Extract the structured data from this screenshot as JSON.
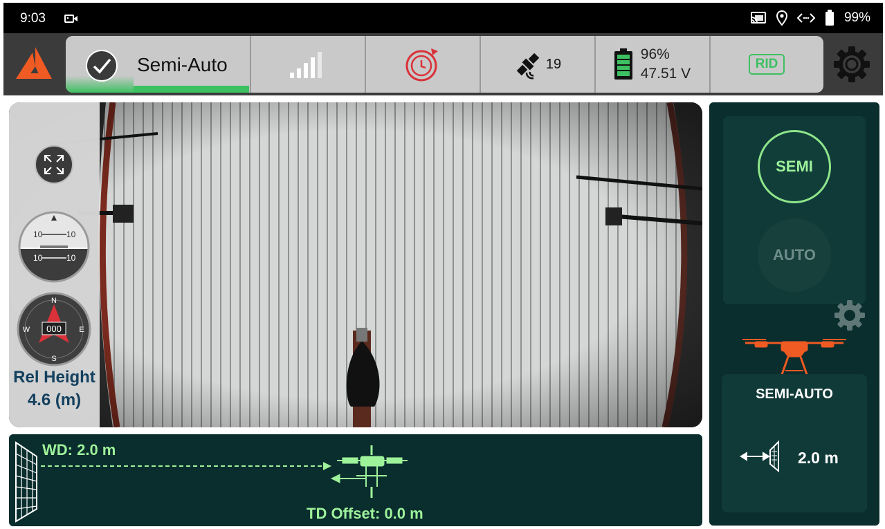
{
  "status_bar": {
    "time": "9:03",
    "battery_percent": "99%",
    "icons": [
      "video-camera-icon",
      "cast-icon",
      "location-pin-icon",
      "code-arrows-icon",
      "battery-icon"
    ]
  },
  "toolbar": {
    "mode_label": "Semi-Auto",
    "satellite_count": "19",
    "battery_percent": "96%",
    "battery_voltage": "47.51 V",
    "rid_label": "RID",
    "signal_bars_active": 4,
    "colors": {
      "ok_green": "#3dc061",
      "alert_red": "#d9323a",
      "strip": "#c9c9c9"
    }
  },
  "camera_view": {
    "rel_height_label": "Rel Height",
    "rel_height_value": "4.6 (m)",
    "attitude_ticks": [
      "10",
      "10",
      "10",
      "10"
    ],
    "compass_heading": "000",
    "compass_letters": [
      "N",
      "E",
      "S",
      "W"
    ]
  },
  "right_panel": {
    "semi_button": "SEMI",
    "auto_button": "AUTO",
    "mode_title": "SEMI-AUTO",
    "distance_value": "2.0 m"
  },
  "bottom_panel": {
    "wd_label": "WD: 2.0 m",
    "td_label": "TD Offset: 0.0 m"
  }
}
